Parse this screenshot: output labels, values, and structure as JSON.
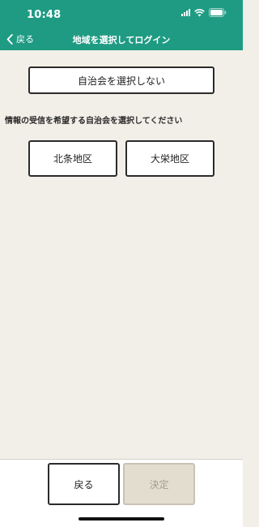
{
  "status_bar": {
    "time": "10:48",
    "icons": [
      "signal-icon",
      "wifi-icon",
      "battery-icon"
    ]
  },
  "nav": {
    "back_label": "戻る",
    "title": "地域を選択してログイン"
  },
  "main": {
    "no_select_label": "自治会を選択しない",
    "instruction": "情報の受信を希望する自治会を選択してください",
    "areas": [
      {
        "label": "北条地区"
      },
      {
        "label": "大栄地区"
      }
    ]
  },
  "footer": {
    "back_label": "戻る",
    "confirm_label": "決定",
    "confirm_disabled": true
  },
  "colors": {
    "header": "#1f9b83",
    "background": "#f2efe8",
    "disabled_button": "#e3ddd0"
  }
}
